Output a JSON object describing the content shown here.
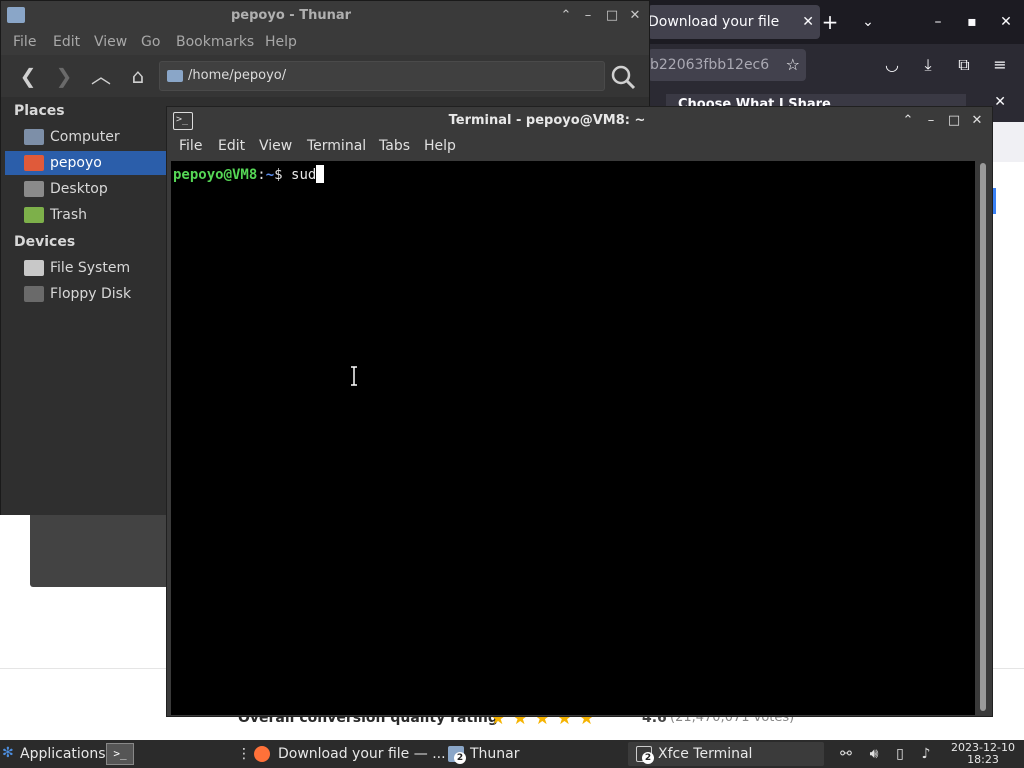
{
  "firefox": {
    "tab_title": "Download your file",
    "tab_close": "✕",
    "new_tab": "+",
    "tab_list": "⌄",
    "win_min": "–",
    "win_max": "▪",
    "win_close": "✕",
    "url": "b22063fbb12ec6",
    "notification_button": "Choose What I Share",
    "notification_close": "✕",
    "rating_label": "Overall conversion quality rating",
    "rating_stars": "★★★★★",
    "rating_score": "4.6",
    "rating_votes": "(21,470,071 votes)"
  },
  "thunar": {
    "title": "pepoyo - Thunar",
    "menu": [
      "File",
      "Edit",
      "View",
      "Go",
      "Bookmarks",
      "Help"
    ],
    "location": "/home/pepoyo/",
    "places_heading": "Places",
    "places": [
      "Computer",
      "pepoyo",
      "Desktop",
      "Trash"
    ],
    "devices_heading": "Devices",
    "devices": [
      "File System",
      "Floppy Disk"
    ],
    "btn_min": "⌃",
    "btn_restore": "–",
    "btn_max": "□",
    "btn_close": "✕"
  },
  "terminal": {
    "title": "Terminal - pepoyo@VM8: ~",
    "menu": [
      "File",
      "Edit",
      "View",
      "Terminal",
      "Tabs",
      "Help"
    ],
    "prompt_user": "pepoyo@VM8",
    "prompt_sep": ":",
    "prompt_path": "~",
    "prompt_symbol": "$ ",
    "command": "sud",
    "btn_up": "⌃",
    "btn_min": "–",
    "btn_max": "□",
    "btn_close": "✕",
    "icon_glyph": ">_"
  },
  "taskbar": {
    "applications_label": "Applications",
    "tasks": [
      {
        "label": "Download your file — ...",
        "badge": ""
      },
      {
        "label": "Thunar",
        "badge": "2"
      },
      {
        "label": "Xfce Terminal",
        "badge": "2"
      }
    ],
    "clock_date": "2023-12-10",
    "clock_time": "18:23"
  },
  "colors": {
    "selection": "#2b5eaa",
    "prompt_user": "#55d655",
    "prompt_path": "#5c8ff0",
    "star": "#f5b301"
  }
}
